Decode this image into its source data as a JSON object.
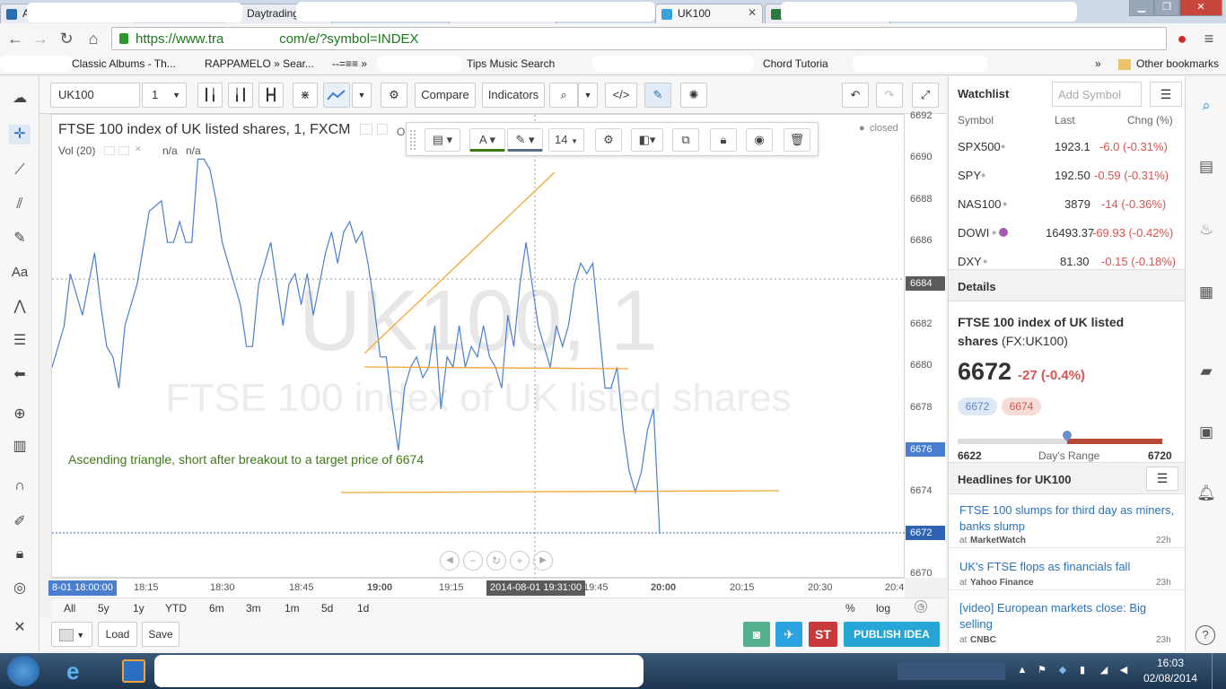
{
  "browser": {
    "tabs": [
      {
        "label": "App"
      },
      {
        "label": "Daytrading"
      },
      {
        "label": "ndl"
      },
      {
        "label": "UK100"
      },
      {
        "label": ""
      }
    ],
    "url": "https://www.tradingview.com/e/?symbol=INDEX",
    "bookmarks": [
      "Classic Albums - Th...",
      "RAPPAMELO » Sear...",
      "--=≡≡ »",
      "Tips Music Search",
      "Chord Tutoria"
    ],
    "bookmarks_more": "»",
    "other_bookmarks": "Other bookmarks"
  },
  "toolbar": {
    "symbol": "UK100",
    "interval": "1",
    "compare_label": "Compare",
    "indicators_label": "Indicators"
  },
  "chart": {
    "legend_title": "FTSE 100 index of UK listed shares, 1, FXCM",
    "legend_o": "O",
    "vol_label": "Vol (20)",
    "vol_val1": "n/a",
    "vol_val2": "n/a",
    "status": "closed",
    "watermark_symbol": "UK100, 1",
    "watermark_desc": "FTSE 100 index of UK listed shares",
    "annotation": "Ascending triangle, short after breakout to a target price of 6674",
    "font_size": "14",
    "price_labels": [
      "6692",
      "6690",
      "6688",
      "6686",
      "6684",
      "6682",
      "6680",
      "6678",
      "6676",
      "6674",
      "6672",
      "6670"
    ],
    "highlight_labels": {
      "crosshair": "6684",
      "low": "6676",
      "last": "6672"
    },
    "time_labels": [
      "8-01 18:00:00",
      "18:15",
      "18:30",
      "18:45",
      "19:00",
      "19:15",
      "2014-08-01 19:31:00",
      "19:45",
      "20:00",
      "20:15",
      "20:30",
      "20:4"
    ],
    "ranges": [
      "All",
      "5y",
      "1y",
      "YTD",
      "6m",
      "3m",
      "1m",
      "5d",
      "1d"
    ],
    "axis_opts": [
      "%",
      "log"
    ]
  },
  "bottom": {
    "load_label": "Load",
    "save_label": "Save",
    "publish_label": "PUBLISH IDEA",
    "st_label": "ST"
  },
  "watchlist": {
    "title": "Watchlist",
    "add_placeholder": "Add Symbol",
    "col_symbol": "Symbol",
    "col_last": "Last",
    "col_chng": "Chng (%)",
    "rows": [
      {
        "symbol": "SPX500",
        "last": "1923.1",
        "chng": "-6.0 (-0.31%)"
      },
      {
        "symbol": "SPY",
        "last": "192.50",
        "chng": "-0.59 (-0.31%)"
      },
      {
        "symbol": "NAS100",
        "last": "3879",
        "chng": "-14 (-0.36%)"
      },
      {
        "symbol": "DOWI",
        "last": "16493.37",
        "chng": "-69.93 (-0.42%)"
      },
      {
        "symbol": "DXY",
        "last": "81.30",
        "chng": "-0.15 (-0.18%)"
      }
    ]
  },
  "details": {
    "title": "Details",
    "name": "FTSE 100 index of UK listed shares",
    "ticker": "(FX:UK100)",
    "price": "6672",
    "change": "-27 (-0.4%)",
    "bid": "6672",
    "ask": "6674",
    "range_low": "6622",
    "range_label": "Day's Range",
    "range_high": "6720"
  },
  "headlines": {
    "title": "Headlines for UK100",
    "items": [
      {
        "text": "FTSE 100 slumps for third day as miners, banks slump",
        "source": "MarketWatch",
        "age": "22h"
      },
      {
        "text": "UK's FTSE flops as financials fall",
        "source": "Yahoo Finance",
        "age": "23h"
      },
      {
        "text": "[video] European markets close: Big selling",
        "source": "CNBC",
        "age": "23h"
      }
    ]
  },
  "taskbar": {
    "time": "16:03",
    "date": "02/08/2014"
  },
  "series": {
    "times": [
      0,
      2,
      3,
      5,
      6,
      7,
      8,
      9,
      10,
      11,
      12,
      14,
      16,
      18,
      19,
      20,
      21,
      22,
      23,
      24,
      25,
      26,
      27,
      28,
      29,
      30,
      31,
      32,
      33,
      34,
      36,
      37,
      38,
      39,
      40,
      41,
      42,
      43,
      44,
      45,
      46,
      47,
      48,
      49,
      50,
      51,
      52,
      53,
      54,
      55,
      56,
      57,
      58,
      59,
      60,
      61,
      62,
      63,
      64,
      65,
      66,
      67,
      68,
      69,
      70,
      71,
      72,
      73,
      74,
      75,
      76,
      77,
      78,
      79,
      80,
      81,
      82,
      83,
      84,
      85,
      86,
      87,
      88,
      89,
      90,
      91,
      92,
      93,
      94,
      95,
      96,
      97,
      98,
      99,
      100
    ],
    "values": [
      6680.0,
      6682.0,
      6684.5,
      6682.5,
      6684.0,
      6685.5,
      6683.0,
      6681.0,
      6680.5,
      6679.0,
      6682.0,
      6684.0,
      6687.5,
      6688.0,
      6686.0,
      6686.0,
      6687.0,
      6686.0,
      6686.0,
      6690.0,
      6690.0,
      6689.5,
      6688.0,
      6686.0,
      6685.0,
      6684.0,
      6683.0,
      6681.0,
      6681.0,
      6684.0,
      6686.0,
      6684.0,
      6682.0,
      6684.0,
      6684.5,
      6683.0,
      6684.5,
      6682.5,
      6684.0,
      6685.5,
      6686.5,
      6685.0,
      6686.5,
      6687.0,
      6686.0,
      6686.5,
      6685.0,
      6683.0,
      6680.5,
      6680.5,
      6678.0,
      6676.0,
      6679.0,
      6680.0,
      6680.5,
      6679.5,
      6680.0,
      6682.0,
      6678.0,
      6680.5,
      6680.0,
      6682.0,
      6680.0,
      6681.0,
      6680.5,
      6682.0,
      6680.5,
      6680.0,
      6679.0,
      6682.5,
      6681.0,
      6684.0,
      6686.0,
      6684.0,
      6682.0,
      6681.0,
      6680.0,
      6682.0,
      6681.0,
      6682.0,
      6684.0,
      6685.0,
      6684.5,
      6685.0,
      6682.0,
      6679.0,
      6679.0,
      6680.0,
      6677.0,
      6675.0,
      6674.0,
      6675.0,
      6677.0,
      6678.0,
      6672.0
    ]
  }
}
